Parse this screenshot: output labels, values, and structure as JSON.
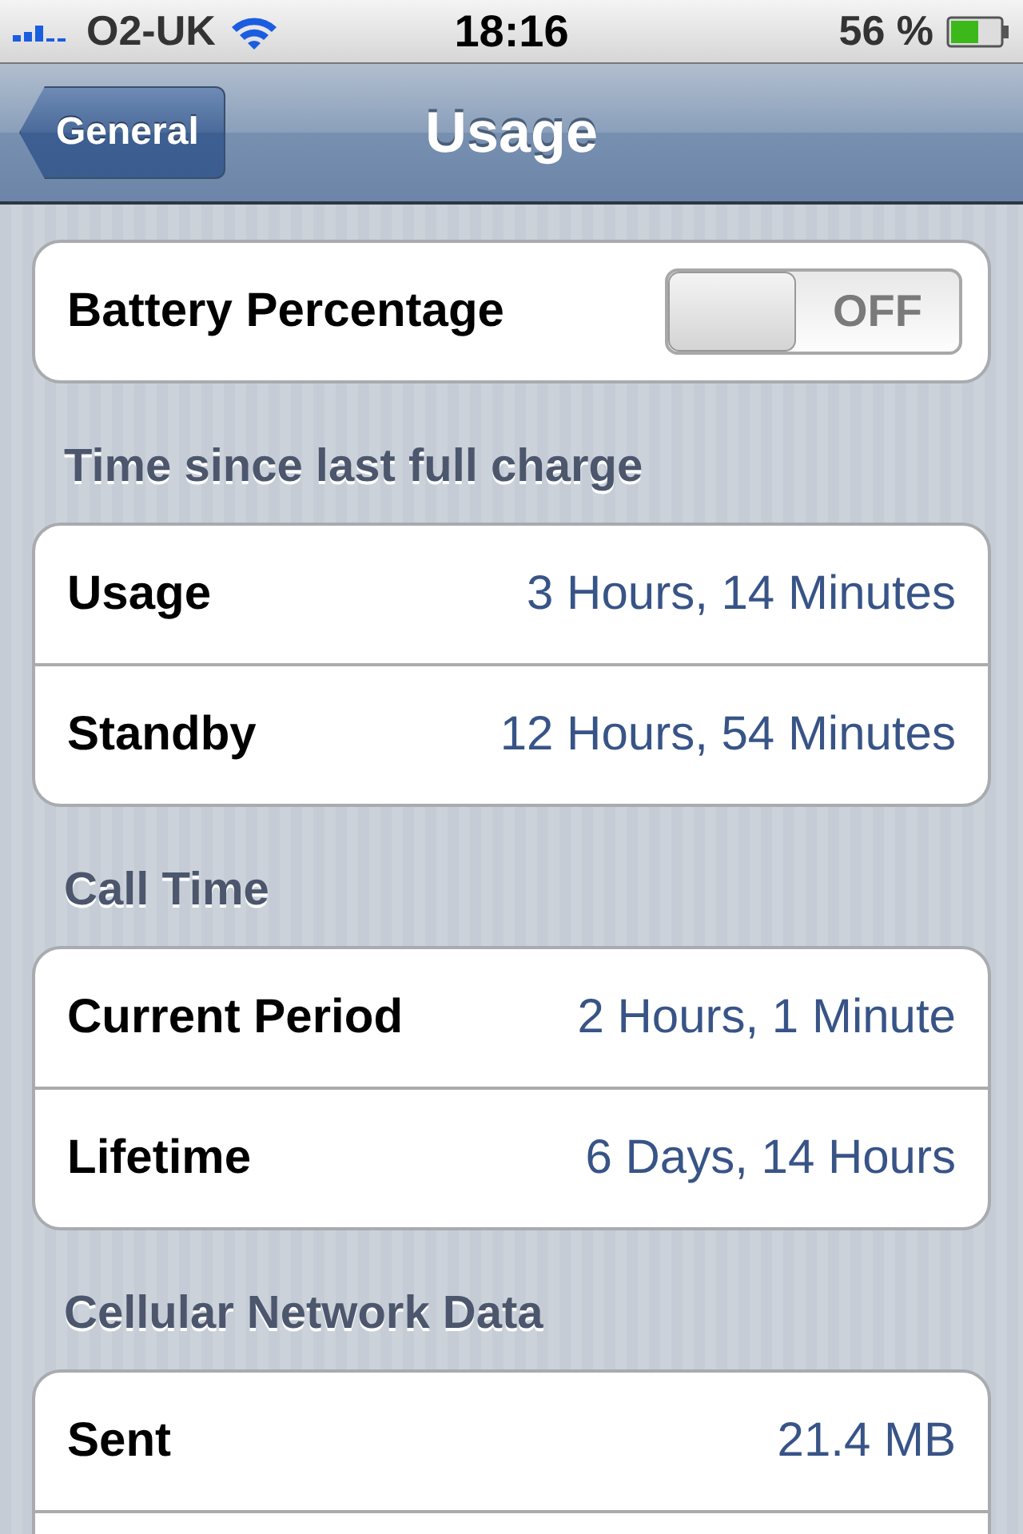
{
  "status_bar": {
    "carrier": "O2-UK",
    "time": "18:16",
    "battery": "56 %"
  },
  "nav_bar": {
    "back": "General",
    "title": "Usage"
  },
  "groups": [
    {
      "rows": [
        {
          "kind": "toggle",
          "label": "Battery Percentage",
          "on": false,
          "toggle_label": "OFF"
        }
      ]
    },
    {
      "header": "Time since last full charge",
      "rows": [
        {
          "kind": "value",
          "label": "Usage",
          "value": "3 Hours, 14 Minutes"
        },
        {
          "kind": "value",
          "label": "Standby",
          "value": "12 Hours, 54 Minutes"
        }
      ]
    },
    {
      "header": "Call Time",
      "rows": [
        {
          "kind": "value",
          "label": "Current Period",
          "value": "2 Hours, 1 Minute"
        },
        {
          "kind": "value",
          "label": "Lifetime",
          "value": "6 Days, 14 Hours"
        }
      ]
    },
    {
      "header": "Cellular Network Data",
      "rows": [
        {
          "kind": "value",
          "label": "Sent",
          "value": "21.4 MB"
        },
        {
          "kind": "blank"
        }
      ]
    }
  ]
}
